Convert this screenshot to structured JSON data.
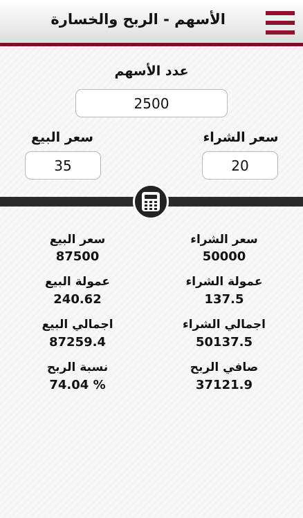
{
  "header": {
    "title": "الأسهم - الربح والخسارة"
  },
  "inputs": {
    "shares": {
      "label": "عدد الأسهم",
      "value": "2500"
    },
    "buy_price": {
      "label": "سعر الشراء",
      "value": "20"
    },
    "sell_price": {
      "label": "سعر البيع",
      "value": "35"
    }
  },
  "results": {
    "buy_price": {
      "label": "سعر الشراء",
      "value": "50000"
    },
    "sell_price": {
      "label": "سعر البيع",
      "value": "87500"
    },
    "buy_commission": {
      "label": "عمولة الشراء",
      "value": "137.5"
    },
    "sell_commission": {
      "label": "عمولة البيع",
      "value": "240.62"
    },
    "total_buy": {
      "label": "اجمالي الشراء",
      "value": "50137.5"
    },
    "total_sell": {
      "label": "اجمالي البيع",
      "value": "87259.4"
    },
    "net_profit": {
      "label": "صافي الربح",
      "value": "37121.9"
    },
    "profit_ratio": {
      "label": "نسبة الربح",
      "value": "74.04 %"
    }
  },
  "colors": {
    "accent": "#7c1125",
    "menu": "#8d1230",
    "divider": "#2b2b2b"
  },
  "icons": {
    "menu": "hamburger-menu-icon",
    "calculate": "calculator-icon"
  }
}
